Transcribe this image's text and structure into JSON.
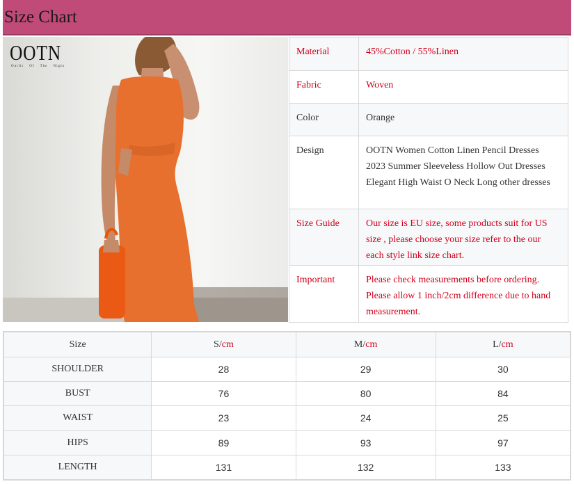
{
  "header": {
    "title": "Size Chart"
  },
  "logo": {
    "main": "OOTN",
    "sub": "Outfit Of The Night"
  },
  "product_image": {
    "alt": "Woman wearing orange sleeveless midi dress holding an orange handbag",
    "dress_color": "#e8702e"
  },
  "colors": {
    "header_bg": "#c04a78",
    "accent_red": "#d0021b"
  },
  "info_rows": [
    {
      "key": "Material",
      "value": "45%Cotton / 55%Linen",
      "red": true
    },
    {
      "key": "Fabric",
      "value": "Woven",
      "red": true
    },
    {
      "key": "Color",
      "value": "Orange",
      "red": false
    },
    {
      "key": "Design",
      "value": "OOTN Women Cotton Linen Pencil Dresses 2023 Summer Sleeveless Hollow Out Dresses Elegant High Waist O Neck Long other dresses",
      "red": false
    },
    {
      "key": "Size Guide",
      "value": "Our size is EU size, some products suit for US size , please choose your size refer to the our each style link size chart.",
      "red": true
    },
    {
      "key": "Important",
      "value": "Please check measurements before ordering. Please allow 1 inch/2cm difference due to hand measurement.",
      "red": true
    }
  ],
  "size_table": {
    "header": {
      "label": "Size",
      "unit": "cm",
      "sizes": [
        "S",
        "M",
        "L"
      ]
    },
    "rows": [
      {
        "name": "SHOULDER",
        "values": [
          "28",
          "29",
          "30"
        ]
      },
      {
        "name": "BUST",
        "values": [
          "76",
          "80",
          "84"
        ]
      },
      {
        "name": "WAIST",
        "values": [
          "23",
          "24",
          "25"
        ]
      },
      {
        "name": "HIPS",
        "values": [
          "89",
          "93",
          "97"
        ]
      },
      {
        "name": "LENGTH",
        "values": [
          "131",
          "132",
          "133"
        ]
      }
    ]
  }
}
